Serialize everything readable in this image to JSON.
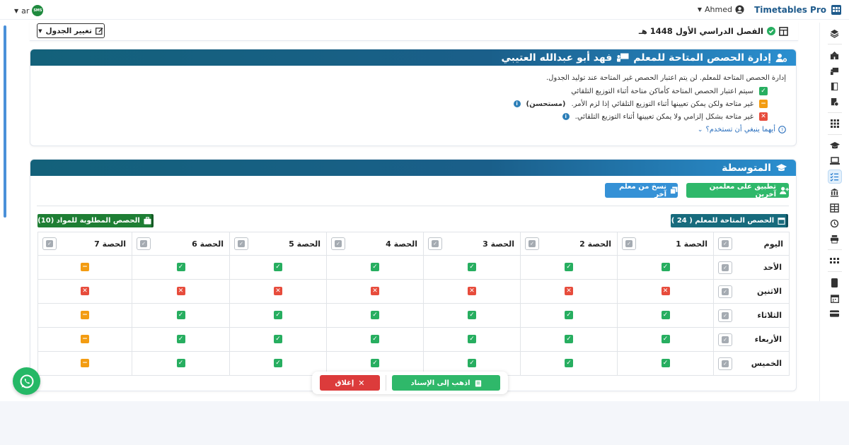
{
  "topbar": {
    "brand": "Timetables Pro",
    "user": "Ahmed",
    "lang": "ar",
    "lang_badge": "SMS"
  },
  "term": {
    "title": "الفصل الدراسي الأول 1448 هـ",
    "change_btn": "تغيير الجدول"
  },
  "availability": {
    "title": "إدارة الحصص المتاحة للمعلم",
    "teacher": "فهد أبو عبدالله العتيبي",
    "desc": "إدارة الحصص المتاحة للمعلم. لن يتم اعتبار الحصص غير المتاحة عند توليد الجدول.",
    "legend_available": "سيتم اعتبار الحصص المتاحة كأماكن متاحة أثناء التوزيع التلقائي",
    "legend_partial": "غير متاحة ولكن يمكن تعيينها أثناء التوزيع التلقائي إذا لزم الأمر.",
    "legend_partial_tag": "(مستحسن)",
    "legend_unavailable": "غير متاحة بشكل إلزامي ولا يمكن تعيينها أثناء التوزيع التلقائي.",
    "which_link": "أيهما ينبغي أن تستخدم؟"
  },
  "stage": {
    "title": "المتوسطة",
    "apply_btn": "تطبيق على معلمين آخرين",
    "copy_btn": "نسخ من معلم آخر",
    "available_tag": "الحصص المتاحة للمعلم ( 24 )",
    "required_tag": "الحصص المطلوبة للمواد (10)"
  },
  "table": {
    "day_header": "اليوم",
    "periods": [
      "الحصة 1",
      "الحصة 2",
      "الحصة 3",
      "الحصة 4",
      "الحصة 5",
      "الحصة 6",
      "الحصة 7"
    ],
    "rows": [
      {
        "day": "الأحد",
        "cells": [
          "g",
          "g",
          "g",
          "g",
          "g",
          "g",
          "o"
        ]
      },
      {
        "day": "الاثنين",
        "cells": [
          "r",
          "r",
          "r",
          "r",
          "r",
          "r",
          "r"
        ]
      },
      {
        "day": "الثلاثاء",
        "cells": [
          "g",
          "g",
          "g",
          "g",
          "g",
          "g",
          "o"
        ]
      },
      {
        "day": "الأربعاء",
        "cells": [
          "g",
          "g",
          "g",
          "g",
          "g",
          "g",
          "o"
        ]
      },
      {
        "day": "الخميس",
        "cells": [
          "g",
          "g",
          "g",
          "g",
          "g",
          "g",
          "o"
        ]
      }
    ]
  },
  "footer": {
    "goto_btn": "اذهب إلى الإسناد",
    "close_btn": "إغلاق"
  },
  "colors": {
    "available": "#27ae60",
    "partial": "#f39c12",
    "unavailable": "#e74c3c",
    "header_from": "#13617a",
    "header_to": "#2b8fd0"
  }
}
